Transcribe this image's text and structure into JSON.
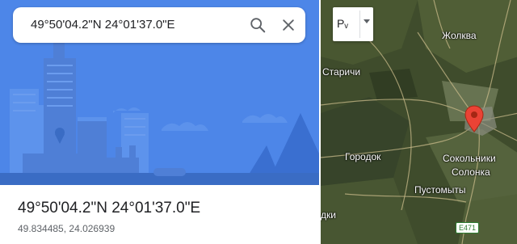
{
  "search": {
    "query": "49°50'04.2\"N 24°01'37.0\"E"
  },
  "place": {
    "title": "49°50'04.2\"N 24°01'37.0\"E",
    "decimal_coords": "49.834485, 24.026939"
  },
  "map": {
    "layer_button_label": "Рᵥ",
    "labels": {
      "zhovkva": "Жолква",
      "starichi": "Старичи",
      "gorodok": "Городок",
      "sokolniki": "Сокольники",
      "solonka": "Солонка",
      "pustomyty": "Пустомыты",
      "dki": "дки"
    },
    "road_shield": "E471"
  },
  "colors": {
    "hero_blue": "#4d86e8",
    "pin_red": "#ea4335",
    "map_bg": "#3f4c2c"
  }
}
